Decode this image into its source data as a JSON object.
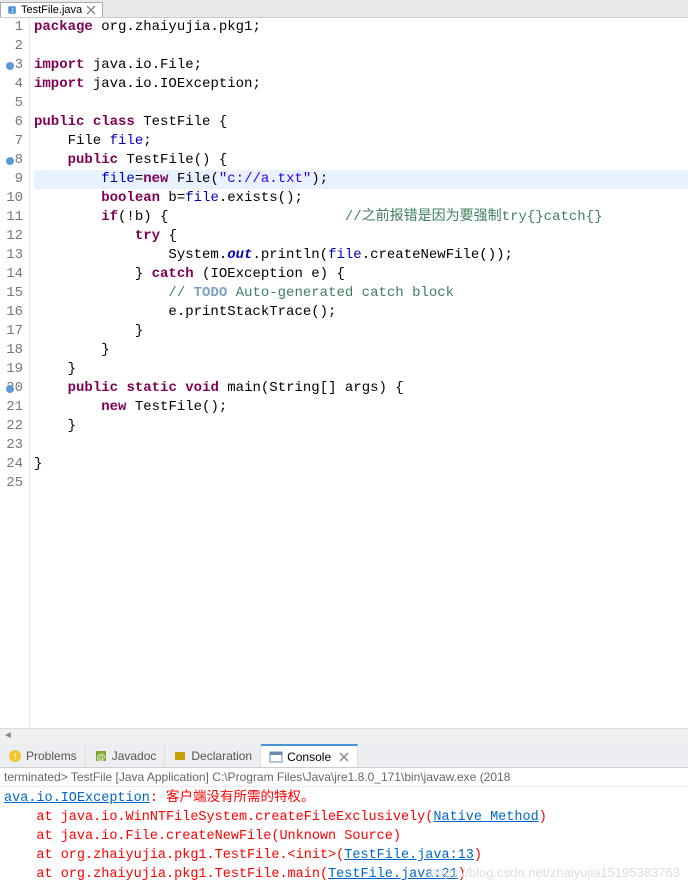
{
  "tab": {
    "title": "TestFile.java"
  },
  "code": {
    "lines": [
      {
        "n": "1",
        "t": [
          {
            "c": "kw",
            "s": "package"
          },
          {
            "s": " org.zhaiyujia.pkg1;"
          }
        ]
      },
      {
        "n": "2",
        "t": []
      },
      {
        "n": "3",
        "t": [
          {
            "c": "kw",
            "s": "import"
          },
          {
            "s": " java.io.File;"
          }
        ],
        "m": "blue"
      },
      {
        "n": "4",
        "t": [
          {
            "c": "kw",
            "s": "import"
          },
          {
            "s": " java.io.IOException;"
          }
        ]
      },
      {
        "n": "5",
        "t": []
      },
      {
        "n": "6",
        "t": [
          {
            "c": "kw",
            "s": "public"
          },
          {
            "s": " "
          },
          {
            "c": "kw",
            "s": "class"
          },
          {
            "s": " TestFile {"
          }
        ]
      },
      {
        "n": "7",
        "t": [
          {
            "s": "    File "
          },
          {
            "c": "fld",
            "s": "file"
          },
          {
            "s": ";"
          }
        ]
      },
      {
        "n": "8",
        "t": [
          {
            "s": "    "
          },
          {
            "c": "kw",
            "s": "public"
          },
          {
            "s": " TestFile() {"
          }
        ],
        "m": "blue"
      },
      {
        "n": "9",
        "t": [
          {
            "s": "        "
          },
          {
            "c": "fld",
            "s": "file"
          },
          {
            "s": "="
          },
          {
            "c": "kw",
            "s": "new"
          },
          {
            "s": " File("
          },
          {
            "c": "str",
            "s": "\"c|://a.txt\""
          },
          {
            "s": ");"
          }
        ],
        "hl": true
      },
      {
        "n": "10",
        "t": [
          {
            "s": "        "
          },
          {
            "c": "kw",
            "s": "boolean"
          },
          {
            "s": " b="
          },
          {
            "c": "fld",
            "s": "file"
          },
          {
            "s": ".exists();"
          }
        ]
      },
      {
        "n": "11",
        "t": [
          {
            "s": "        "
          },
          {
            "c": "kw",
            "s": "if"
          },
          {
            "s": "(!b) {                     "
          },
          {
            "c": "com",
            "s": "//之前报错是因为要强制try{}catch{}"
          }
        ]
      },
      {
        "n": "12",
        "t": [
          {
            "s": "            "
          },
          {
            "c": "kw",
            "s": "try"
          },
          {
            "s": " {"
          }
        ]
      },
      {
        "n": "13",
        "t": [
          {
            "s": "                System."
          },
          {
            "c": "stat",
            "s": "out"
          },
          {
            "s": ".println("
          },
          {
            "c": "fld",
            "s": "file"
          },
          {
            "s": ".createNewFile());"
          }
        ]
      },
      {
        "n": "14",
        "t": [
          {
            "s": "            } "
          },
          {
            "c": "kw",
            "s": "catch"
          },
          {
            "s": " (IOException e) {"
          }
        ]
      },
      {
        "n": "15",
        "t": [
          {
            "s": "                "
          },
          {
            "c": "com",
            "s": "// "
          },
          {
            "c": "todo",
            "s": "TODO"
          },
          {
            "c": "com",
            "s": " Auto-generated catch block"
          }
        ]
      },
      {
        "n": "16",
        "t": [
          {
            "s": "                e.printStackTrace();"
          }
        ]
      },
      {
        "n": "17",
        "t": [
          {
            "s": "            }"
          }
        ]
      },
      {
        "n": "18",
        "t": [
          {
            "s": "        }"
          }
        ]
      },
      {
        "n": "19",
        "t": [
          {
            "s": "    }"
          }
        ]
      },
      {
        "n": "20",
        "t": [
          {
            "s": "    "
          },
          {
            "c": "kw",
            "s": "public"
          },
          {
            "s": " "
          },
          {
            "c": "kw",
            "s": "static"
          },
          {
            "s": " "
          },
          {
            "c": "kw",
            "s": "void"
          },
          {
            "s": " main(String[] args) {"
          }
        ],
        "m": "blue"
      },
      {
        "n": "21",
        "t": [
          {
            "s": "        "
          },
          {
            "c": "kw",
            "s": "new"
          },
          {
            "s": " TestFile();"
          }
        ]
      },
      {
        "n": "22",
        "t": [
          {
            "s": "    }"
          }
        ]
      },
      {
        "n": "23",
        "t": []
      },
      {
        "n": "24",
        "t": [
          {
            "s": "}"
          }
        ]
      },
      {
        "n": "25",
        "t": []
      }
    ]
  },
  "panel": {
    "tabs": [
      "Problems",
      "Javadoc",
      "Declaration",
      "Console"
    ],
    "active": 3,
    "console_title": "terminated> TestFile [Java Application] C:\\Program Files\\Java\\jre1.8.0_171\\bin\\javaw.exe (2018",
    "lines": [
      {
        "pre": "",
        "link": "ava.io.IOException",
        "post": ": 客户端没有所需的特权。",
        "linkcls": "lnk"
      },
      {
        "pre": "    at java.io.WinNTFileSystem.createFileExclusively(",
        "link": "Native Method",
        "post": ")"
      },
      {
        "pre": "    at java.io.File.createNewFile(Unknown Source)",
        "link": "",
        "post": ""
      },
      {
        "pre": "    at org.zhaiyujia.pkg1.TestFile.<init>(",
        "link": "TestFile.java:13",
        "post": ")"
      },
      {
        "pre": "    at org.zhaiyujia.pkg1.TestFile.main(",
        "link": "TestFile.java:21",
        "post": ")"
      }
    ]
  },
  "watermark": "https://blog.csdn.net/zhaiyujia15195383763"
}
